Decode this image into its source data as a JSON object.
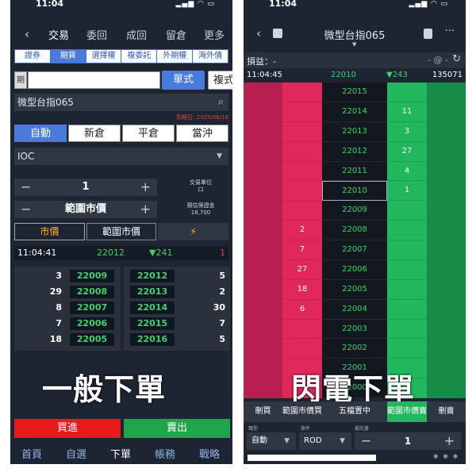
{
  "left": {
    "status_time": "11:04",
    "nav": {
      "back": "‹",
      "items": [
        "交易",
        "委回",
        "成回",
        "留倉",
        "更多"
      ]
    },
    "market_tabs": [
      {
        "label": "證券",
        "active": false
      },
      {
        "label": "期貨",
        "active": true
      },
      {
        "label": "選擇權",
        "active": false
      },
      {
        "label": "複委託",
        "active": false
      },
      {
        "label": "外期權",
        "active": false
      },
      {
        "label": "海外債",
        "active": false
      }
    ],
    "code_prefix": "期",
    "mode_buttons": {
      "single": "單式",
      "combo": "複式"
    },
    "product": "微型台指065",
    "due_date": "到期日: 2025/06/18",
    "order_types": [
      {
        "label": "自動",
        "active": true
      },
      {
        "label": "新倉",
        "active": false
      },
      {
        "label": "平倉",
        "active": false
      },
      {
        "label": "當沖",
        "active": false
      }
    ],
    "time_in_force": "IOC",
    "qty": "1",
    "unit_label": "交易單位",
    "unit_value": "口",
    "price_mode": "範圍市價",
    "margin_label": "預估保證金",
    "margin_value": "18,700",
    "price_types": {
      "market": "市價",
      "range": "範圍市價",
      "flash": "⚡"
    },
    "quote": {
      "time": "11:04:41",
      "price": "22012",
      "change": "▼241",
      "qty": "1"
    },
    "book_left": [
      {
        "qty": "3",
        "px": "22009"
      },
      {
        "qty": "29",
        "px": "22008"
      },
      {
        "qty": "8",
        "px": "22007"
      },
      {
        "qty": "7",
        "px": "22006"
      },
      {
        "qty": "18",
        "px": "22005"
      }
    ],
    "book_right": [
      {
        "qty": "5",
        "px": "22012"
      },
      {
        "qty": "2",
        "px": "22013"
      },
      {
        "qty": "30",
        "px": "22014"
      },
      {
        "qty": "7",
        "px": "22015"
      },
      {
        "qty": "5",
        "px": "22016"
      }
    ],
    "caption": "一般下單",
    "buy": "買進",
    "sell": "賣出",
    "bottom_nav": [
      {
        "label": "首頁",
        "active": false
      },
      {
        "label": "自選",
        "active": false
      },
      {
        "label": "下單",
        "active": true
      },
      {
        "label": "帳務",
        "active": false
      },
      {
        "label": "戰略",
        "active": false
      }
    ]
  },
  "right": {
    "status_time": "11:04",
    "title": "微型台指065",
    "pl_label": "損益：-",
    "pl_value": "- @ -",
    "quote": {
      "time": "11:04:45",
      "price": "22010",
      "change": "▼243",
      "volume": "135071"
    },
    "ladder": [
      {
        "buy": "",
        "px": "22015",
        "sell": ""
      },
      {
        "buy": "",
        "px": "22014",
        "sell": "11"
      },
      {
        "buy": "",
        "px": "22013",
        "sell": "3"
      },
      {
        "buy": "",
        "px": "22012",
        "sell": "27"
      },
      {
        "buy": "",
        "px": "22011",
        "sell": "4"
      },
      {
        "buy": "",
        "px": "22010",
        "sell": "1"
      },
      {
        "buy": "",
        "px": "22009",
        "sell": ""
      },
      {
        "buy": "2",
        "px": "22008",
        "sell": ""
      },
      {
        "buy": "7",
        "px": "22007",
        "sell": ""
      },
      {
        "buy": "27",
        "px": "22006",
        "sell": ""
      },
      {
        "buy": "18",
        "px": "22005",
        "sell": ""
      },
      {
        "buy": "6",
        "px": "22004",
        "sell": ""
      },
      {
        "buy": "",
        "px": "22003",
        "sell": ""
      },
      {
        "buy": "",
        "px": "22002",
        "sell": ""
      },
      {
        "buy": "",
        "px": "22001",
        "sell": ""
      },
      {
        "buy": "",
        "px": "22000",
        "sell": ""
      }
    ],
    "caption": "閃電下單",
    "actions": [
      "刪買",
      "範圍市價買",
      "五檔置中",
      "範圍市價賣",
      "刪賣"
    ],
    "form": {
      "type_label": "類型",
      "type_value": "自動",
      "cond_label": "條件",
      "cond_value": "ROD",
      "qty_label": "委託量",
      "qty_value": "1"
    }
  }
}
